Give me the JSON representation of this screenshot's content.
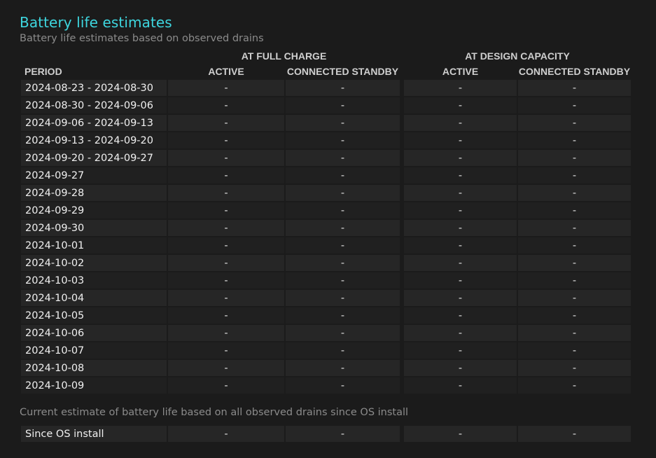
{
  "header": {
    "title": "Battery life estimates",
    "subtitle": "Battery life estimates based on observed drains"
  },
  "table": {
    "group_full_charge": "AT FULL CHARGE",
    "group_design_capacity": "AT DESIGN CAPACITY",
    "col_period": "PERIOD",
    "col_fc_active": "ACTIVE",
    "col_fc_standby": "CONNECTED STANDBY",
    "col_dc_active": "ACTIVE",
    "col_dc_standby": "CONNECTED STANDBY",
    "rows": [
      {
        "period": "2024-08-23 - 2024-08-30",
        "fc_active": "-",
        "fc_standby": "-",
        "dc_active": "-",
        "dc_standby": "-"
      },
      {
        "period": "2024-08-30 - 2024-09-06",
        "fc_active": "-",
        "fc_standby": "-",
        "dc_active": "-",
        "dc_standby": "-"
      },
      {
        "period": "2024-09-06 - 2024-09-13",
        "fc_active": "-",
        "fc_standby": "-",
        "dc_active": "-",
        "dc_standby": "-"
      },
      {
        "period": "2024-09-13 - 2024-09-20",
        "fc_active": "-",
        "fc_standby": "-",
        "dc_active": "-",
        "dc_standby": "-"
      },
      {
        "period": "2024-09-20 - 2024-09-27",
        "fc_active": "-",
        "fc_standby": "-",
        "dc_active": "-",
        "dc_standby": "-"
      },
      {
        "period": "2024-09-27",
        "fc_active": "-",
        "fc_standby": "-",
        "dc_active": "-",
        "dc_standby": "-"
      },
      {
        "period": "2024-09-28",
        "fc_active": "-",
        "fc_standby": "-",
        "dc_active": "-",
        "dc_standby": "-"
      },
      {
        "period": "2024-09-29",
        "fc_active": "-",
        "fc_standby": "-",
        "dc_active": "-",
        "dc_standby": "-"
      },
      {
        "period": "2024-09-30",
        "fc_active": "-",
        "fc_standby": "-",
        "dc_active": "-",
        "dc_standby": "-"
      },
      {
        "period": "2024-10-01",
        "fc_active": "-",
        "fc_standby": "-",
        "dc_active": "-",
        "dc_standby": "-"
      },
      {
        "period": "2024-10-02",
        "fc_active": "-",
        "fc_standby": "-",
        "dc_active": "-",
        "dc_standby": "-"
      },
      {
        "period": "2024-10-03",
        "fc_active": "-",
        "fc_standby": "-",
        "dc_active": "-",
        "dc_standby": "-"
      },
      {
        "period": "2024-10-04",
        "fc_active": "-",
        "fc_standby": "-",
        "dc_active": "-",
        "dc_standby": "-"
      },
      {
        "period": "2024-10-05",
        "fc_active": "-",
        "fc_standby": "-",
        "dc_active": "-",
        "dc_standby": "-"
      },
      {
        "period": "2024-10-06",
        "fc_active": "-",
        "fc_standby": "-",
        "dc_active": "-",
        "dc_standby": "-"
      },
      {
        "period": "2024-10-07",
        "fc_active": "-",
        "fc_standby": "-",
        "dc_active": "-",
        "dc_standby": "-"
      },
      {
        "period": "2024-10-08",
        "fc_active": "-",
        "fc_standby": "-",
        "dc_active": "-",
        "dc_standby": "-"
      },
      {
        "period": "2024-10-09",
        "fc_active": "-",
        "fc_standby": "-",
        "dc_active": "-",
        "dc_standby": "-"
      }
    ]
  },
  "install": {
    "note": "Current estimate of battery life based on all observed drains since OS install",
    "row": {
      "period": "Since OS install",
      "fc_active": "-",
      "fc_standby": "-",
      "dc_active": "-",
      "dc_standby": "-"
    }
  },
  "colors": {
    "title": "#3ed6df",
    "background": "#1b1b1b",
    "row_odd": "#262626",
    "row_even": "#202020"
  }
}
